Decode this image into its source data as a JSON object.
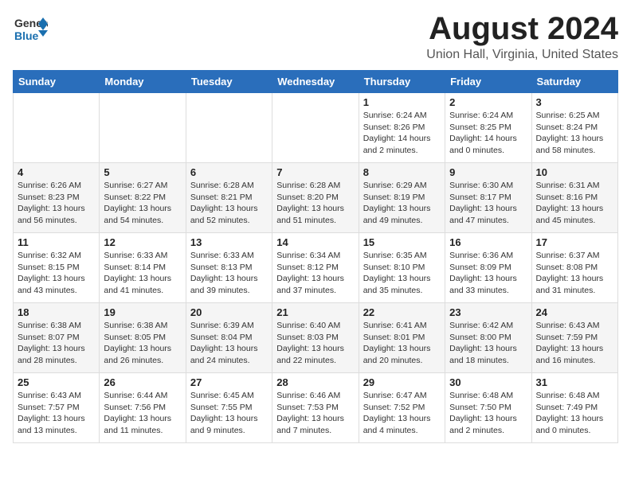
{
  "header": {
    "logo_general": "General",
    "logo_blue": "Blue",
    "month_title": "August 2024",
    "subtitle": "Union Hall, Virginia, United States"
  },
  "calendar": {
    "days_of_week": [
      "Sunday",
      "Monday",
      "Tuesday",
      "Wednesday",
      "Thursday",
      "Friday",
      "Saturday"
    ],
    "weeks": [
      [
        {
          "day": "",
          "info": ""
        },
        {
          "day": "",
          "info": ""
        },
        {
          "day": "",
          "info": ""
        },
        {
          "day": "",
          "info": ""
        },
        {
          "day": "1",
          "info": "Sunrise: 6:24 AM\nSunset: 8:26 PM\nDaylight: 14 hours\nand 2 minutes."
        },
        {
          "day": "2",
          "info": "Sunrise: 6:24 AM\nSunset: 8:25 PM\nDaylight: 14 hours\nand 0 minutes."
        },
        {
          "day": "3",
          "info": "Sunrise: 6:25 AM\nSunset: 8:24 PM\nDaylight: 13 hours\nand 58 minutes."
        }
      ],
      [
        {
          "day": "4",
          "info": "Sunrise: 6:26 AM\nSunset: 8:23 PM\nDaylight: 13 hours\nand 56 minutes."
        },
        {
          "day": "5",
          "info": "Sunrise: 6:27 AM\nSunset: 8:22 PM\nDaylight: 13 hours\nand 54 minutes."
        },
        {
          "day": "6",
          "info": "Sunrise: 6:28 AM\nSunset: 8:21 PM\nDaylight: 13 hours\nand 52 minutes."
        },
        {
          "day": "7",
          "info": "Sunrise: 6:28 AM\nSunset: 8:20 PM\nDaylight: 13 hours\nand 51 minutes."
        },
        {
          "day": "8",
          "info": "Sunrise: 6:29 AM\nSunset: 8:19 PM\nDaylight: 13 hours\nand 49 minutes."
        },
        {
          "day": "9",
          "info": "Sunrise: 6:30 AM\nSunset: 8:17 PM\nDaylight: 13 hours\nand 47 minutes."
        },
        {
          "day": "10",
          "info": "Sunrise: 6:31 AM\nSunset: 8:16 PM\nDaylight: 13 hours\nand 45 minutes."
        }
      ],
      [
        {
          "day": "11",
          "info": "Sunrise: 6:32 AM\nSunset: 8:15 PM\nDaylight: 13 hours\nand 43 minutes."
        },
        {
          "day": "12",
          "info": "Sunrise: 6:33 AM\nSunset: 8:14 PM\nDaylight: 13 hours\nand 41 minutes."
        },
        {
          "day": "13",
          "info": "Sunrise: 6:33 AM\nSunset: 8:13 PM\nDaylight: 13 hours\nand 39 minutes."
        },
        {
          "day": "14",
          "info": "Sunrise: 6:34 AM\nSunset: 8:12 PM\nDaylight: 13 hours\nand 37 minutes."
        },
        {
          "day": "15",
          "info": "Sunrise: 6:35 AM\nSunset: 8:10 PM\nDaylight: 13 hours\nand 35 minutes."
        },
        {
          "day": "16",
          "info": "Sunrise: 6:36 AM\nSunset: 8:09 PM\nDaylight: 13 hours\nand 33 minutes."
        },
        {
          "day": "17",
          "info": "Sunrise: 6:37 AM\nSunset: 8:08 PM\nDaylight: 13 hours\nand 31 minutes."
        }
      ],
      [
        {
          "day": "18",
          "info": "Sunrise: 6:38 AM\nSunset: 8:07 PM\nDaylight: 13 hours\nand 28 minutes."
        },
        {
          "day": "19",
          "info": "Sunrise: 6:38 AM\nSunset: 8:05 PM\nDaylight: 13 hours\nand 26 minutes."
        },
        {
          "day": "20",
          "info": "Sunrise: 6:39 AM\nSunset: 8:04 PM\nDaylight: 13 hours\nand 24 minutes."
        },
        {
          "day": "21",
          "info": "Sunrise: 6:40 AM\nSunset: 8:03 PM\nDaylight: 13 hours\nand 22 minutes."
        },
        {
          "day": "22",
          "info": "Sunrise: 6:41 AM\nSunset: 8:01 PM\nDaylight: 13 hours\nand 20 minutes."
        },
        {
          "day": "23",
          "info": "Sunrise: 6:42 AM\nSunset: 8:00 PM\nDaylight: 13 hours\nand 18 minutes."
        },
        {
          "day": "24",
          "info": "Sunrise: 6:43 AM\nSunset: 7:59 PM\nDaylight: 13 hours\nand 16 minutes."
        }
      ],
      [
        {
          "day": "25",
          "info": "Sunrise: 6:43 AM\nSunset: 7:57 PM\nDaylight: 13 hours\nand 13 minutes."
        },
        {
          "day": "26",
          "info": "Sunrise: 6:44 AM\nSunset: 7:56 PM\nDaylight: 13 hours\nand 11 minutes."
        },
        {
          "day": "27",
          "info": "Sunrise: 6:45 AM\nSunset: 7:55 PM\nDaylight: 13 hours\nand 9 minutes."
        },
        {
          "day": "28",
          "info": "Sunrise: 6:46 AM\nSunset: 7:53 PM\nDaylight: 13 hours\nand 7 minutes."
        },
        {
          "day": "29",
          "info": "Sunrise: 6:47 AM\nSunset: 7:52 PM\nDaylight: 13 hours\nand 4 minutes."
        },
        {
          "day": "30",
          "info": "Sunrise: 6:48 AM\nSunset: 7:50 PM\nDaylight: 13 hours\nand 2 minutes."
        },
        {
          "day": "31",
          "info": "Sunrise: 6:48 AM\nSunset: 7:49 PM\nDaylight: 13 hours\nand 0 minutes."
        }
      ]
    ]
  }
}
